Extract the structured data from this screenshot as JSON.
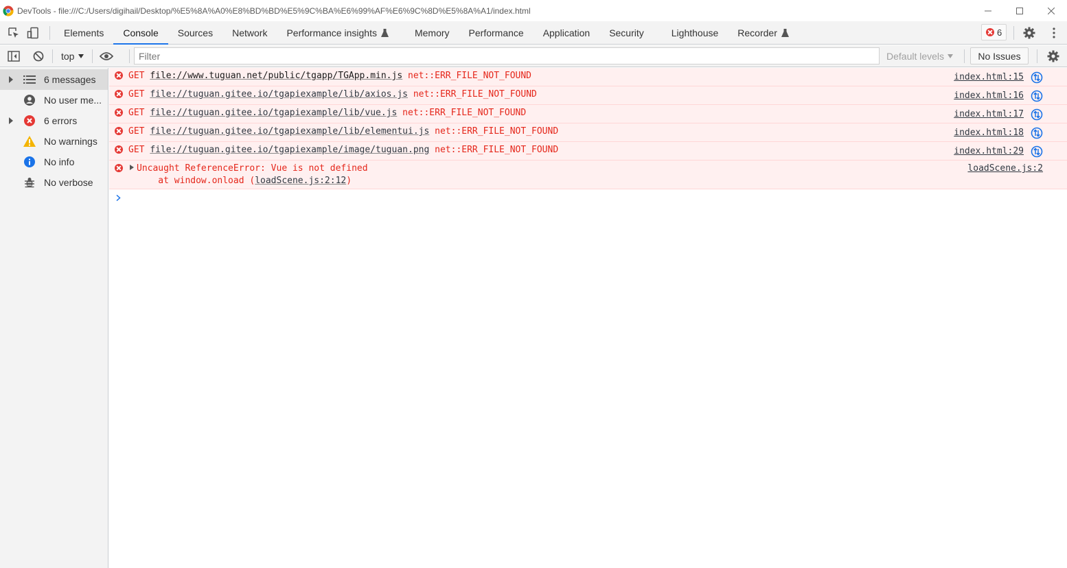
{
  "window": {
    "title": "DevTools - file:///C:/Users/digihail/Desktop/%E5%8A%A0%E8%BD%BD%E5%9C%BA%E6%99%AF%E6%9C%8D%E5%8A%A1/index.html"
  },
  "tabs": [
    {
      "label": "Elements"
    },
    {
      "label": "Console"
    },
    {
      "label": "Sources"
    },
    {
      "label": "Network"
    },
    {
      "label": "Performance insights"
    },
    {
      "label": "Memory"
    },
    {
      "label": "Performance"
    },
    {
      "label": "Application"
    },
    {
      "label": "Security"
    },
    {
      "label": "Lighthouse"
    },
    {
      "label": "Recorder"
    }
  ],
  "error_badge_count": "6",
  "toolbar": {
    "context": "top",
    "filter_placeholder": "Filter",
    "levels": "Default levels",
    "issues": "No Issues"
  },
  "sidebar": {
    "items": [
      {
        "label": "6 messages"
      },
      {
        "label": "No user me..."
      },
      {
        "label": "6 errors"
      },
      {
        "label": "No warnings"
      },
      {
        "label": "No info"
      },
      {
        "label": "No verbose"
      }
    ]
  },
  "messages": [
    {
      "method": "GET",
      "url": "file://www.tuguan.net/public/tgapp/TGApp.min.js",
      "error": "net::ERR_FILE_NOT_FOUND",
      "source": "index.html:15"
    },
    {
      "method": "GET",
      "url": "file://tuguan.gitee.io/tgapiexample/lib/axios.js",
      "error": "net::ERR_FILE_NOT_FOUND",
      "source": "index.html:16"
    },
    {
      "method": "GET",
      "url": "file://tuguan.gitee.io/tgapiexample/lib/vue.js",
      "error": "net::ERR_FILE_NOT_FOUND",
      "source": "index.html:17"
    },
    {
      "method": "GET",
      "url": "file://tuguan.gitee.io/tgapiexample/lib/elementui.js",
      "error": "net::ERR_FILE_NOT_FOUND",
      "source": "index.html:18"
    },
    {
      "method": "GET",
      "url": "file://tuguan.gitee.io/tgapiexample/image/tuguan.png",
      "error": "net::ERR_FILE_NOT_FOUND",
      "source": "index.html:29"
    }
  ],
  "exception": {
    "text": "Uncaught ReferenceError: Vue is not defined",
    "stack_prefix": "    at window.onload (",
    "stack_link": "loadScene.js:2:12",
    "stack_suffix": ")",
    "source": "loadScene.js:2"
  },
  "colors": {
    "error": "#e5261a",
    "error_bg": "#fff0f0",
    "accent": "#1a73e8"
  }
}
